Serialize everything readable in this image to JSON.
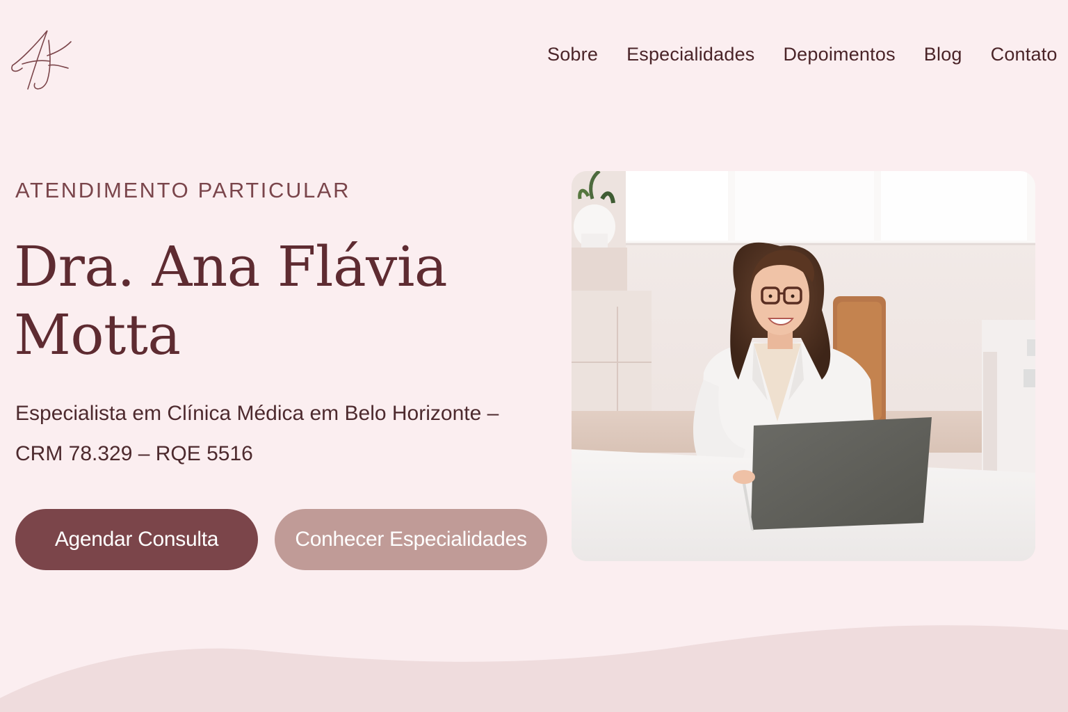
{
  "header": {
    "nav": [
      {
        "label": "Sobre"
      },
      {
        "label": "Especialidades"
      },
      {
        "label": "Depoimentos"
      },
      {
        "label": "Blog"
      },
      {
        "label": "Contato"
      }
    ]
  },
  "hero": {
    "eyebrow": "ATENDIMENTO PARTICULAR",
    "title_line1": "Dra. Ana Flávia",
    "title_line2": "Motta",
    "subtitle_line1": "Especialista em Clínica Médica em Belo Horizonte –",
    "subtitle_line2": "CRM 78.329 – RQE 5516",
    "primary_button": "Agendar Consulta",
    "secondary_button": "Conhecer Especialidades"
  },
  "colors": {
    "background": "#fbeef0",
    "primary": "#7b454a",
    "secondary": "#c09b97",
    "text": "#5e2b31",
    "wave": "#efdcdd"
  }
}
